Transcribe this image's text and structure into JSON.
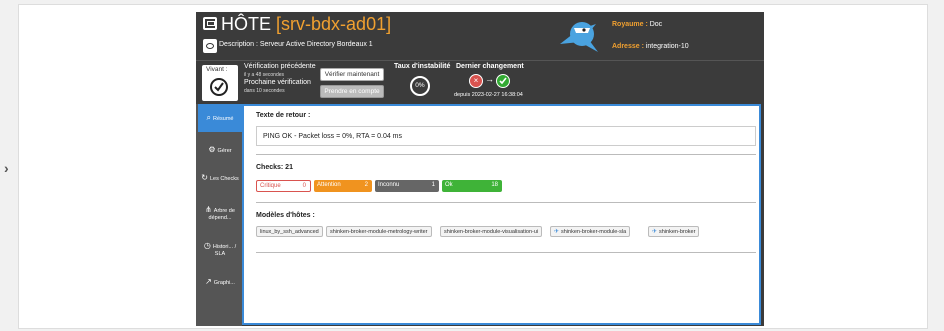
{
  "header": {
    "title_prefix": "HÔTE",
    "title_name": "srv-bdx-ad01",
    "description_label": "Description : ",
    "description": "Serveur Active Directory Bordeaux 1",
    "realm_label": "Royaume : ",
    "realm": "Doc",
    "address_label": "Adresse : ",
    "address": "integration-10"
  },
  "status": {
    "alive_label": "Vivant :",
    "prev_check_label": "Vérification précédente",
    "prev_check_time": "il y a 48 secondes",
    "next_check_label": "Prochaine vérification",
    "next_check_time": "dans 10 secondes",
    "verify_button": "Vérifier maintenant",
    "take_button": "Prendre en compte",
    "instability_label": "Taux d'instabilité",
    "instability_value": "0%",
    "last_change_label": "Dernier changement",
    "since": "depuis 2023-02-27 16:38:04"
  },
  "sidebar": {
    "items": [
      {
        "label": "Résumé",
        "icon": "search-icon"
      },
      {
        "label": "Gérer",
        "icon": "gears-icon"
      },
      {
        "label": "Les Checks",
        "icon": "refresh-icon"
      },
      {
        "label": "Arbre de dépend...",
        "icon": "tree-icon"
      },
      {
        "label": "Histori... / SLA",
        "icon": "history-icon"
      },
      {
        "label": "Graphi...",
        "icon": "graph-icon"
      }
    ]
  },
  "main": {
    "output_label": "Texte de retour :",
    "output": "PING OK - Packet loss = 0%, RTA = 0.04 ms",
    "checks_label": "Checks: 21",
    "checks": [
      {
        "label": "Critique",
        "count": "0",
        "color": "#d9534f"
      },
      {
        "label": "Attention",
        "count": "2",
        "color": "#f0931f"
      },
      {
        "label": "Inconnu",
        "count": "1",
        "color": "#666666"
      },
      {
        "label": "Ok",
        "count": "18",
        "color": "#3fb338"
      }
    ],
    "templates_label": "Modèles d'hôtes :",
    "templates": [
      "linux_by_ssh_advanced",
      "shinken-broker-module-metrology-writer",
      "shinken-broker-module-visualisation-ui",
      "shinken-broker-module-sla",
      "shinken-broker"
    ]
  }
}
